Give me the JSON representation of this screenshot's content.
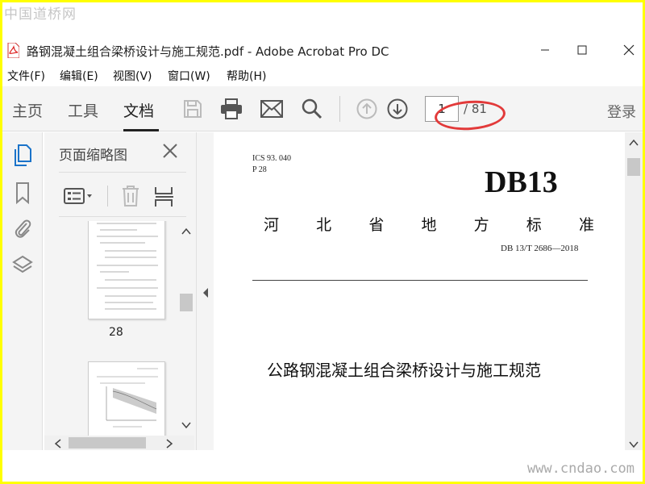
{
  "watermark": {
    "top": "中国道桥网",
    "bottom": "www.cndao.com"
  },
  "window": {
    "title": "路钢混凝土组合梁桥设计与施工规范.pdf - Adobe Acrobat Pro DC"
  },
  "menu": {
    "items": [
      "文件(F)",
      "编辑(E)",
      "视图(V)",
      "窗口(W)",
      "帮助(H)"
    ]
  },
  "toolbar": {
    "tabs": [
      "主页",
      "工具",
      "文档"
    ],
    "active_tab": "文档",
    "page_current": "1",
    "page_total": "/ 81",
    "login": "登录",
    "icons": [
      "save-icon",
      "print-icon",
      "email-icon",
      "search-icon",
      "prev-page-icon",
      "next-page-icon"
    ]
  },
  "sidebar": {
    "icons": [
      "page-thumbnails-icon",
      "bookmark-icon",
      "attachment-icon",
      "layers-icon"
    ]
  },
  "thumbnails": {
    "title": "页面缩略图",
    "page_label": "28"
  },
  "document": {
    "ics": "ICS   93. 040",
    "p": "P  28",
    "db_code": "DB13",
    "province_chars": [
      "河",
      "北",
      "省",
      "地",
      "方",
      "标",
      "准"
    ],
    "standard_number": "DB 13/T  2686—2018",
    "title": "公路钢混凝土组合梁桥设计与施工规范"
  },
  "colors": {
    "accent": "#1a73c9",
    "annotation": "#e23a3a",
    "border": "#ffff00"
  }
}
